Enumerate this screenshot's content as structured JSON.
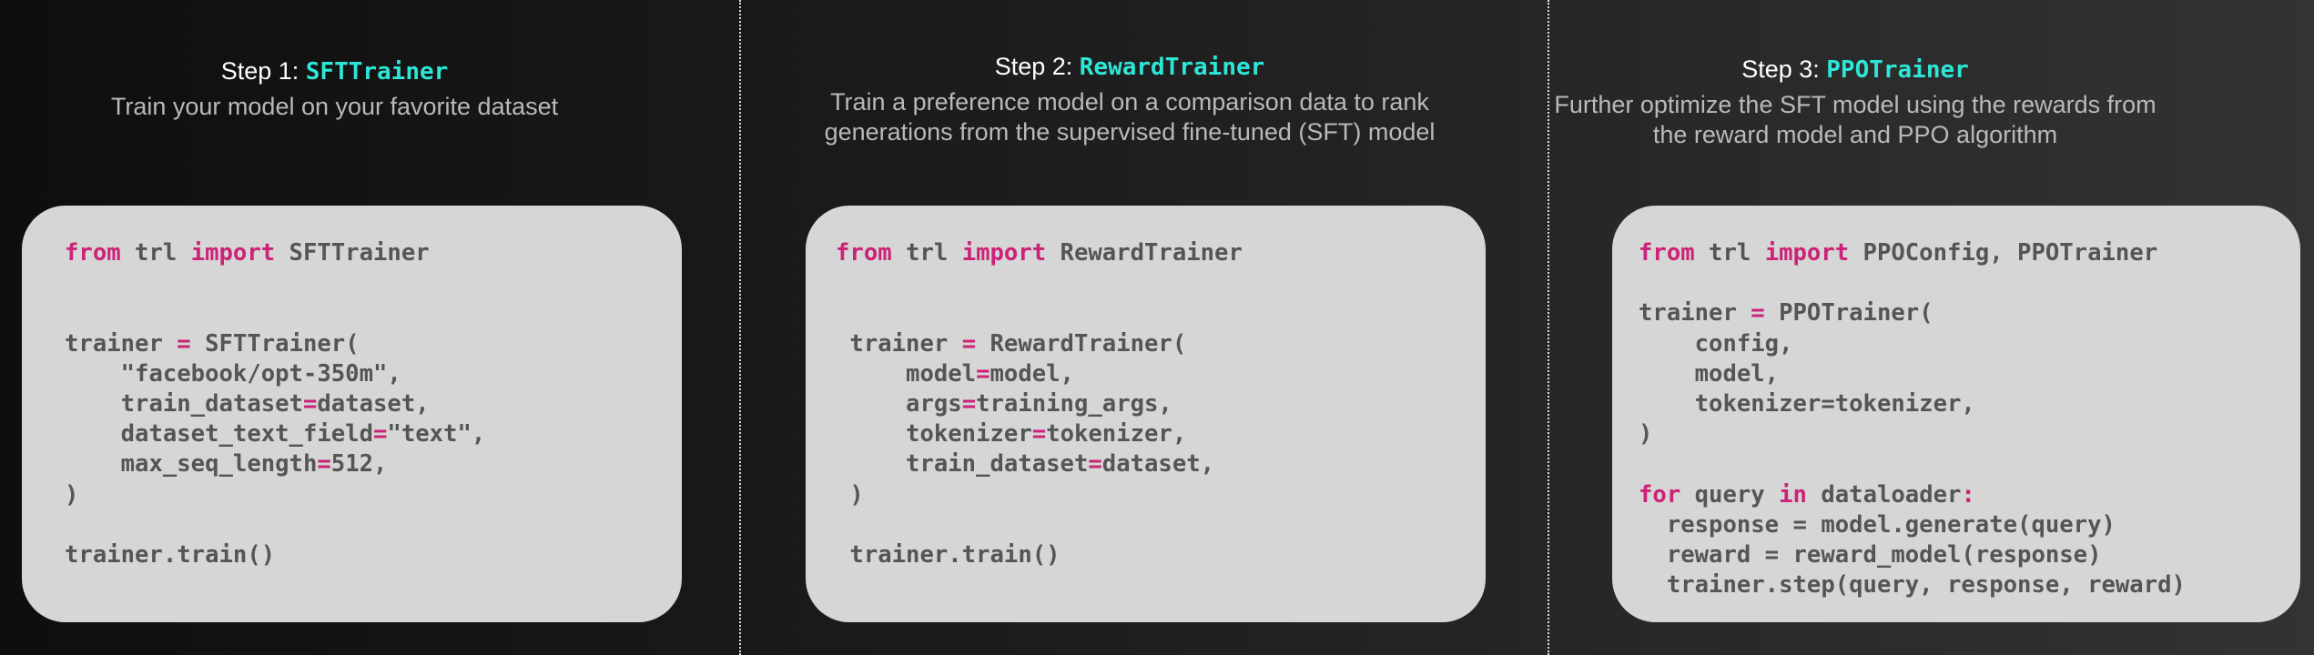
{
  "steps": [
    {
      "prefix": "Step 1: ",
      "trainer": "SFTTrainer",
      "description": "Train your model on your favorite dataset",
      "code": [
        [
          {
            "k": 1,
            "t": "from"
          },
          {
            "t": " trl "
          },
          {
            "k": 1,
            "t": "import"
          },
          {
            "t": " SFTTrainer"
          }
        ],
        [],
        [],
        [
          {
            "t": "trainer "
          },
          {
            "k": 1,
            "t": "="
          },
          {
            "t": " SFTTrainer("
          }
        ],
        [
          {
            "t": "    \"facebook/opt-350m\","
          }
        ],
        [
          {
            "t": "    train_dataset"
          },
          {
            "k": 1,
            "t": "="
          },
          {
            "t": "dataset,"
          }
        ],
        [
          {
            "t": "    dataset_text_field"
          },
          {
            "k": 1,
            "t": "="
          },
          {
            "t": "\"text\","
          }
        ],
        [
          {
            "t": "    max_seq_length"
          },
          {
            "k": 1,
            "t": "="
          },
          {
            "t": "512,"
          }
        ],
        [
          {
            "t": ")"
          }
        ],
        [],
        [
          {
            "t": "trainer.train()"
          }
        ]
      ]
    },
    {
      "prefix": "Step 2: ",
      "trainer": "RewardTrainer",
      "description": "Train a preference model on a comparison data to rank generations from the supervised fine-tuned (SFT) model",
      "code": [
        [
          {
            "k": 1,
            "t": "from"
          },
          {
            "t": " trl "
          },
          {
            "k": 1,
            "t": "import"
          },
          {
            "t": " RewardTrainer"
          }
        ],
        [],
        [],
        [
          {
            "t": " trainer "
          },
          {
            "k": 1,
            "t": "="
          },
          {
            "t": " RewardTrainer("
          }
        ],
        [
          {
            "t": "     model"
          },
          {
            "k": 1,
            "t": "="
          },
          {
            "t": "model,"
          }
        ],
        [
          {
            "t": "     args"
          },
          {
            "k": 1,
            "t": "="
          },
          {
            "t": "training_args,"
          }
        ],
        [
          {
            "t": "     tokenizer"
          },
          {
            "k": 1,
            "t": "="
          },
          {
            "t": "tokenizer,"
          }
        ],
        [
          {
            "t": "     train_dataset"
          },
          {
            "k": 1,
            "t": "="
          },
          {
            "t": "dataset,"
          }
        ],
        [
          {
            "t": " )"
          }
        ],
        [],
        [
          {
            "t": " trainer.train()"
          }
        ]
      ]
    },
    {
      "prefix": "Step 3: ",
      "trainer": "PPOTrainer",
      "description": "Further optimize the SFT model using the rewards from the reward model and PPO algorithm",
      "code": [
        [
          {
            "k": 1,
            "t": "from"
          },
          {
            "t": " trl "
          },
          {
            "k": 1,
            "t": "import"
          },
          {
            "t": " PPOConfig, PPOTrainer"
          }
        ],
        [],
        [
          {
            "t": "trainer "
          },
          {
            "k": 1,
            "t": "="
          },
          {
            "t": " PPOTrainer("
          }
        ],
        [
          {
            "t": "    config,"
          }
        ],
        [
          {
            "t": "    model,"
          }
        ],
        [
          {
            "t": "    tokenizer=tokenizer,"
          }
        ],
        [
          {
            "t": ")"
          }
        ],
        [],
        [
          {
            "k": 1,
            "t": "for"
          },
          {
            "t": " query "
          },
          {
            "k": 1,
            "t": "in"
          },
          {
            "t": " dataloader"
          },
          {
            "k": 1,
            "t": ":"
          }
        ],
        [
          {
            "t": "  response = model.generate(query)"
          }
        ],
        [
          {
            "t": "  reward = reward_model(response)"
          }
        ],
        [
          {
            "t": "  trainer.step(query, response, reward)"
          }
        ]
      ]
    }
  ]
}
